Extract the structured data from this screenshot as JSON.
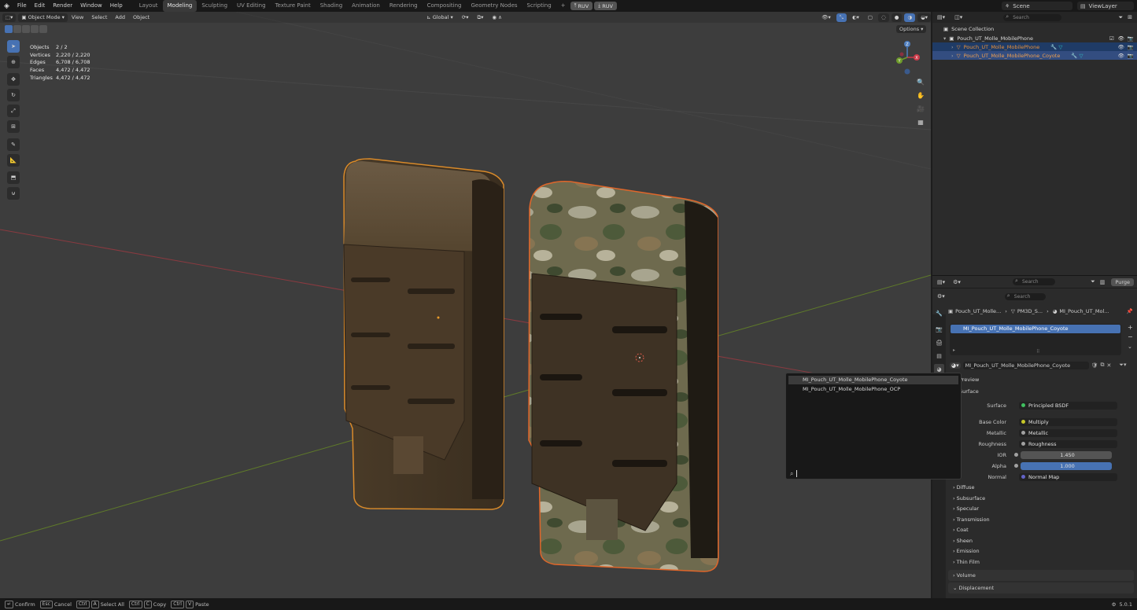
{
  "topbar": {
    "menus": [
      "File",
      "Edit",
      "Render",
      "Window",
      "Help"
    ],
    "workspaces": [
      "Layout",
      "Modeling",
      "Sculpting",
      "UV Editing",
      "Texture Paint",
      "Shading",
      "Animation",
      "Rendering",
      "Compositing",
      "Geometry Nodes",
      "Scripting"
    ],
    "active_workspace": "Modeling",
    "plus": "+",
    "addon_buttons": [
      "RUV",
      "RUV"
    ],
    "scene": "Scene",
    "view_layer": "ViewLayer"
  },
  "viewport": {
    "mode": "Object Mode",
    "menus": [
      "View",
      "Select",
      "Add",
      "Object"
    ],
    "orientation": "Global",
    "options": "Options",
    "stats": [
      {
        "label": "Objects",
        "value": "2 / 2"
      },
      {
        "label": "Vertices",
        "value": "2,220 / 2,220"
      },
      {
        "label": "Edges",
        "value": "6,708 / 6,708"
      },
      {
        "label": "Faces",
        "value": "4,472 / 4,472"
      },
      {
        "label": "Triangles",
        "value": "4,472 / 4,472"
      }
    ],
    "gizmo_labels": {
      "y": "Y",
      "x": "X",
      "z": "Z"
    }
  },
  "outliner": {
    "search_placeholder": "Search",
    "collection": "Scene Collection",
    "items": [
      {
        "name": "Pouch_UT_Molle_MobilePhone"
      },
      {
        "name": "Pouch_UT_Molle_MobilePhone"
      },
      {
        "name": "Pouch_UT_Molle_MobilePhone_Coyote"
      }
    ]
  },
  "props_header": {
    "search_placeholder": "Search",
    "purge": "Purge"
  },
  "properties": {
    "search_placeholder": "Search",
    "breadcrumb": [
      "Pouch_UT_Molle...",
      "PM3D_S...",
      "MI_Pouch_UT_Mol..."
    ],
    "slot": "MI_Pouch_UT_Molle_MobilePhone_Coyote",
    "material_name": "MI_Pouch_UT_Molle_MobilePhone_Coyote",
    "panels": {
      "preview": "Preview",
      "surface": "Surface"
    },
    "rows": [
      {
        "label": "Surface",
        "value": "Principled BSDF",
        "color": "#3fbf5f",
        "kind": "link"
      },
      {
        "label": "Base Color",
        "value": "Multiply",
        "color": "#c7c729",
        "kind": "link"
      },
      {
        "label": "Metallic",
        "value": "Metallic",
        "color": "#a1a1a1",
        "kind": "link"
      },
      {
        "label": "Roughness",
        "value": "Roughness",
        "color": "#a1a1a1",
        "kind": "link"
      },
      {
        "label": "IOR",
        "value": "1.450",
        "color": "#a1a1a1",
        "kind": "num"
      },
      {
        "label": "Alpha",
        "value": "1.000",
        "color": "#a1a1a1",
        "kind": "blue"
      },
      {
        "label": "Normal",
        "value": "Normal Map",
        "color": "#6363c7",
        "kind": "link"
      }
    ],
    "subpanels": [
      "Diffuse",
      "Subsurface",
      "Specular",
      "Transmission",
      "Coat",
      "Sheen",
      "Emission",
      "Thin Film"
    ],
    "volume": "Volume",
    "displacement": "Displacement"
  },
  "dropdown": {
    "items": [
      "MI_Pouch_UT_Molle_MobilePhone_Coyote",
      "MI_Pouch_UT_Molle_MobilePhone_OCP"
    ]
  },
  "statusbar": {
    "hints": [
      {
        "key": "↵",
        "label": "Confirm"
      },
      {
        "key": "Esc",
        "label": "Cancel"
      },
      {
        "key": "Ctrl",
        "key2": "A",
        "label": "Select All"
      },
      {
        "key": "Ctrl",
        "key2": "C",
        "label": "Copy"
      },
      {
        "key": "Ctrl",
        "key2": "V",
        "label": "Paste"
      }
    ],
    "version": "5.0.1"
  }
}
